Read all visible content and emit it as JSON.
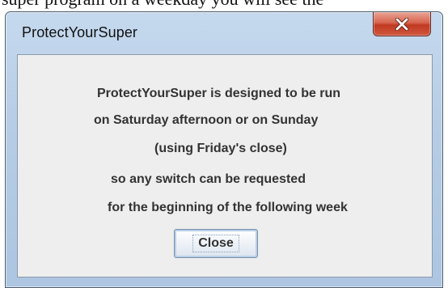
{
  "background": {
    "partial_text": "super program on a weekday you will see the"
  },
  "window": {
    "title": "ProtectYourSuper",
    "close_icon": "close-x-icon",
    "close_icon_color": "#ffffff",
    "close_button_color": "#c7442b"
  },
  "message": {
    "lines": [
      "ProtectYourSuper is designed to be run",
      "on Saturday afternoon or on Sunday",
      "(using Friday's close)",
      "so any switch can be requested",
      "for the beginning of the following week"
    ]
  },
  "buttons": {
    "close_label": "Close"
  }
}
